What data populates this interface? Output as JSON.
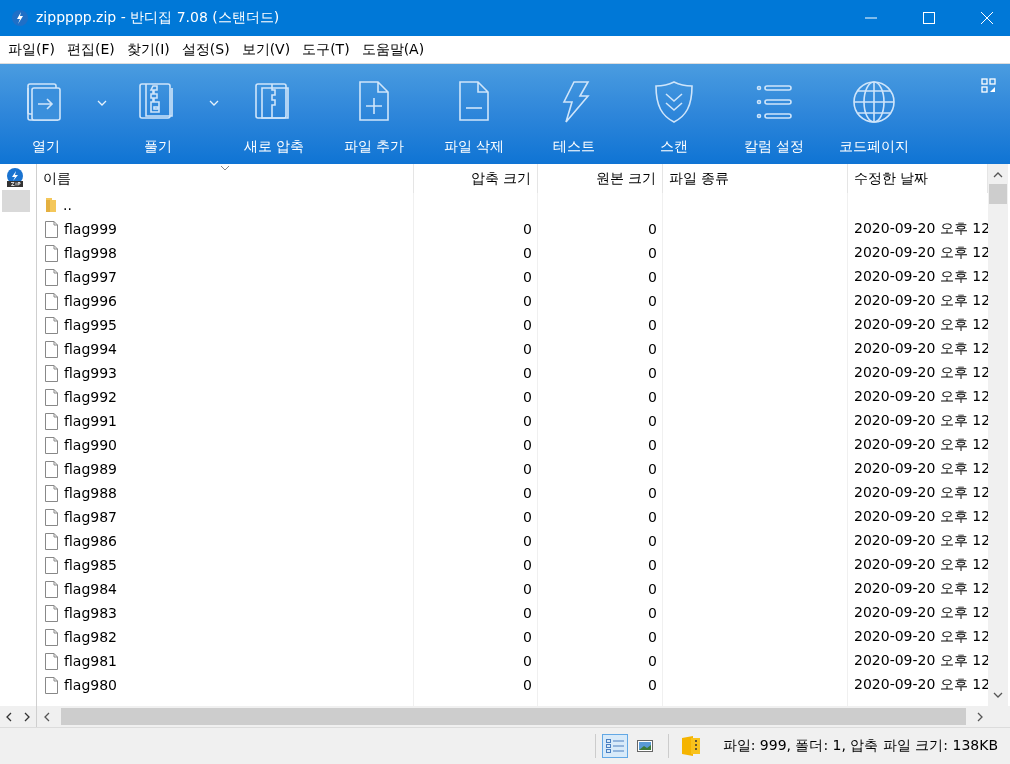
{
  "window": {
    "title": "zippppp.zip - 반디집 7.08 (스탠더드)"
  },
  "menu": [
    "파일(F)",
    "편집(E)",
    "찾기(I)",
    "설정(S)",
    "보기(V)",
    "도구(T)",
    "도움말(A)"
  ],
  "toolbar": [
    {
      "label": "열기",
      "has_dropdown": true
    },
    {
      "label": "풀기",
      "has_dropdown": true
    },
    {
      "label": "새로 압축",
      "has_dropdown": false
    },
    {
      "label": "파일 추가",
      "has_dropdown": false
    },
    {
      "label": "파일 삭제",
      "has_dropdown": false
    },
    {
      "label": "테스트",
      "has_dropdown": false
    },
    {
      "label": "스캔",
      "has_dropdown": false
    },
    {
      "label": "칼럼 설정",
      "has_dropdown": false
    },
    {
      "label": "코드페이지",
      "has_dropdown": false
    }
  ],
  "file_list": {
    "columns": [
      {
        "label": "이름",
        "sorted": true
      },
      {
        "label": "압축 크기",
        "sorted": false
      },
      {
        "label": "원본 크기",
        "sorted": false
      },
      {
        "label": "파일 종류",
        "sorted": false
      },
      {
        "label": "수정한 날짜",
        "sorted": false
      }
    ],
    "rows": [
      {
        "kind": "folder",
        "name": ".."
      },
      {
        "kind": "file",
        "name": "flag999",
        "compressed_size": "0",
        "original_size": "0",
        "modified": "2020-09-20 오후 12"
      },
      {
        "kind": "file",
        "name": "flag998",
        "compressed_size": "0",
        "original_size": "0",
        "modified": "2020-09-20 오후 12"
      },
      {
        "kind": "file",
        "name": "flag997",
        "compressed_size": "0",
        "original_size": "0",
        "modified": "2020-09-20 오후 12"
      },
      {
        "kind": "file",
        "name": "flag996",
        "compressed_size": "0",
        "original_size": "0",
        "modified": "2020-09-20 오후 12"
      },
      {
        "kind": "file",
        "name": "flag995",
        "compressed_size": "0",
        "original_size": "0",
        "modified": "2020-09-20 오후 12"
      },
      {
        "kind": "file",
        "name": "flag994",
        "compressed_size": "0",
        "original_size": "0",
        "modified": "2020-09-20 오후 12"
      },
      {
        "kind": "file",
        "name": "flag993",
        "compressed_size": "0",
        "original_size": "0",
        "modified": "2020-09-20 오후 12"
      },
      {
        "kind": "file",
        "name": "flag992",
        "compressed_size": "0",
        "original_size": "0",
        "modified": "2020-09-20 오후 12"
      },
      {
        "kind": "file",
        "name": "flag991",
        "compressed_size": "0",
        "original_size": "0",
        "modified": "2020-09-20 오후 12"
      },
      {
        "kind": "file",
        "name": "flag990",
        "compressed_size": "0",
        "original_size": "0",
        "modified": "2020-09-20 오후 12"
      },
      {
        "kind": "file",
        "name": "flag989",
        "compressed_size": "0",
        "original_size": "0",
        "modified": "2020-09-20 오후 12"
      },
      {
        "kind": "file",
        "name": "flag988",
        "compressed_size": "0",
        "original_size": "0",
        "modified": "2020-09-20 오후 12"
      },
      {
        "kind": "file",
        "name": "flag987",
        "compressed_size": "0",
        "original_size": "0",
        "modified": "2020-09-20 오후 12"
      },
      {
        "kind": "file",
        "name": "flag986",
        "compressed_size": "0",
        "original_size": "0",
        "modified": "2020-09-20 오후 12"
      },
      {
        "kind": "file",
        "name": "flag985",
        "compressed_size": "0",
        "original_size": "0",
        "modified": "2020-09-20 오후 12"
      },
      {
        "kind": "file",
        "name": "flag984",
        "compressed_size": "0",
        "original_size": "0",
        "modified": "2020-09-20 오후 12"
      },
      {
        "kind": "file",
        "name": "flag983",
        "compressed_size": "0",
        "original_size": "0",
        "modified": "2020-09-20 오후 12"
      },
      {
        "kind": "file",
        "name": "flag982",
        "compressed_size": "0",
        "original_size": "0",
        "modified": "2020-09-20 오후 12"
      },
      {
        "kind": "file",
        "name": "flag981",
        "compressed_size": "0",
        "original_size": "0",
        "modified": "2020-09-20 오후 12"
      },
      {
        "kind": "file",
        "name": "flag980",
        "compressed_size": "0",
        "original_size": "0",
        "modified": "2020-09-20 오후 12"
      }
    ]
  },
  "status_bar": {
    "views": [
      {
        "selected": true
      },
      {
        "selected": false
      }
    ],
    "text": "파일: 999, 폴더: 1, 압축 파일 크기: 138KB"
  }
}
